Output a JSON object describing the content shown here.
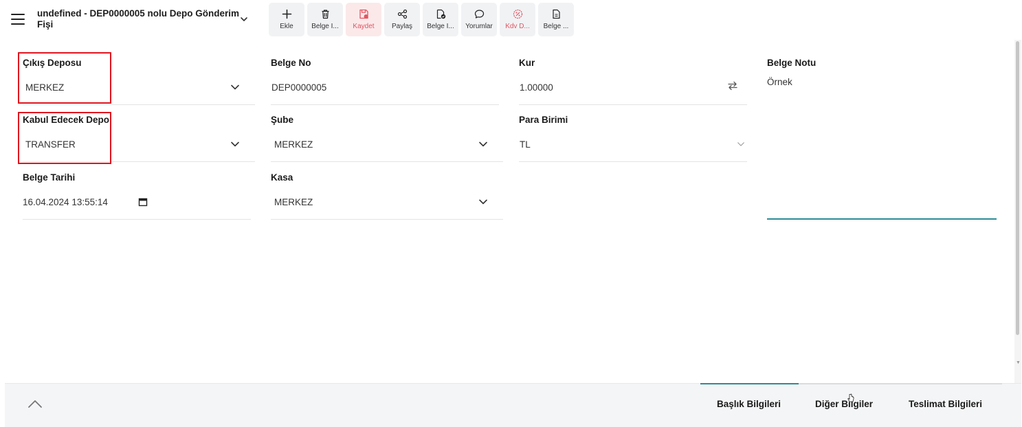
{
  "header": {
    "title": "undefined - DEP0000005 nolu Depo Gönderim Fişi"
  },
  "toolbar": [
    {
      "label": "Ekle",
      "icon": "plus-icon"
    },
    {
      "label": "Belge İ...",
      "icon": "trash-icon"
    },
    {
      "label": "Kaydet",
      "icon": "save-icon"
    },
    {
      "label": "Paylaş",
      "icon": "share-icon"
    },
    {
      "label": "Belge İ...",
      "icon": "document-check-icon"
    },
    {
      "label": "Yorumlar",
      "icon": "comment-icon"
    },
    {
      "label": "Kdv D...",
      "icon": "percent-badge-icon"
    },
    {
      "label": "Belge ...",
      "icon": "document-icon"
    }
  ],
  "form": {
    "cikis_deposu": {
      "label": "Çıkış Deposu",
      "value": "MERKEZ"
    },
    "kabul_edecek_depo": {
      "label": "Kabul Edecek Depo",
      "value": "TRANSFER"
    },
    "belge_tarihi": {
      "label": "Belge Tarihi",
      "value": "16.04.2024 13:55:14"
    },
    "belge_no": {
      "label": "Belge No",
      "value": "DEP0000005"
    },
    "sube": {
      "label": "Şube",
      "value": "MERKEZ"
    },
    "kasa": {
      "label": "Kasa",
      "value": "MERKEZ"
    },
    "kur": {
      "label": "Kur",
      "value": "1.00000"
    },
    "para_birimi": {
      "label": "Para Birimi",
      "value": "TL"
    },
    "belge_notu": {
      "label": "Belge Notu",
      "value": "Örnek"
    }
  },
  "tabs": [
    {
      "label": "Başlık Bilgileri",
      "active": true
    },
    {
      "label": "Diğer Bilgiler",
      "active": false
    },
    {
      "label": "Teslimat Bilgileri",
      "active": false
    }
  ],
  "colors": {
    "accent": "#2b8c96",
    "highlight": "#e0141e",
    "danger": "#e05561"
  }
}
